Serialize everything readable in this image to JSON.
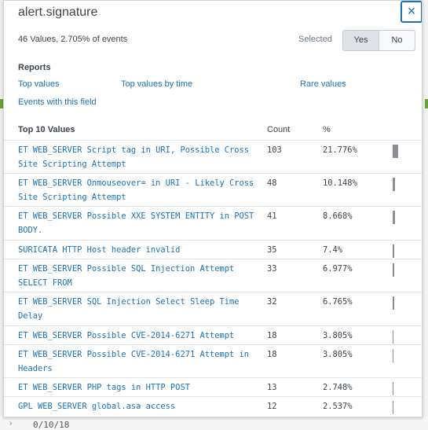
{
  "background": {
    "bottom_text": "0/10/18"
  },
  "panel": {
    "title": "alert.signature",
    "close_glyph": "×",
    "summary": "46 Values, 2.705% of events",
    "selected_label": "Selected",
    "toggle": {
      "yes": "Yes",
      "no": "No",
      "active": "Yes"
    },
    "reports_heading": "Reports",
    "links": {
      "top_values": "Top values",
      "top_values_by_time": "Top values by time",
      "rare_values": "Rare values",
      "events_with_field": "Events with this field"
    },
    "top10_heading": "Top 10 Values",
    "columns": {
      "count": "Count",
      "percent": "%"
    }
  },
  "values": [
    {
      "value": "ET WEB_SERVER Script tag in URI, Possible Cross Site Scripting Attempt",
      "count": "103",
      "percent": "21.776%",
      "share": 21.776
    },
    {
      "value": "ET WEB_SERVER Onmouseover= in URI - Likely Cross Site Scripting Attempt",
      "count": "48",
      "percent": "10.148%",
      "share": 10.148
    },
    {
      "value": "ET WEB_SERVER Possible XXE SYSTEM ENTITY in POST BODY.",
      "count": "41",
      "percent": "8.668%",
      "share": 8.668
    },
    {
      "value": "SURICATA HTTP Host header invalid",
      "count": "35",
      "percent": "7.4%",
      "share": 7.4
    },
    {
      "value": "ET WEB_SERVER Possible SQL Injection Attempt SELECT FROM",
      "count": "33",
      "percent": "6.977%",
      "share": 6.977
    },
    {
      "value": "ET WEB_SERVER SQL Injection Select Sleep Time Delay",
      "count": "32",
      "percent": "6.765%",
      "share": 6.765
    },
    {
      "value": "ET WEB_SERVER Possible CVE-2014-6271 Attempt",
      "count": "18",
      "percent": "3.805%",
      "share": 3.805
    },
    {
      "value": "ET WEB_SERVER Possible CVE-2014-6271 Attempt in Headers",
      "count": "18",
      "percent": "3.805%",
      "share": 3.805
    },
    {
      "value": "ET WEB_SERVER PHP tags in HTTP POST",
      "count": "13",
      "percent": "2.748%",
      "share": 2.748
    },
    {
      "value": "GPL WEB_SERVER global.asa access",
      "count": "12",
      "percent": "2.537%",
      "share": 2.537
    }
  ],
  "colors": {
    "link": "#1a72b8",
    "bar": "#8a8f96",
    "accent_green": "#65a637"
  }
}
